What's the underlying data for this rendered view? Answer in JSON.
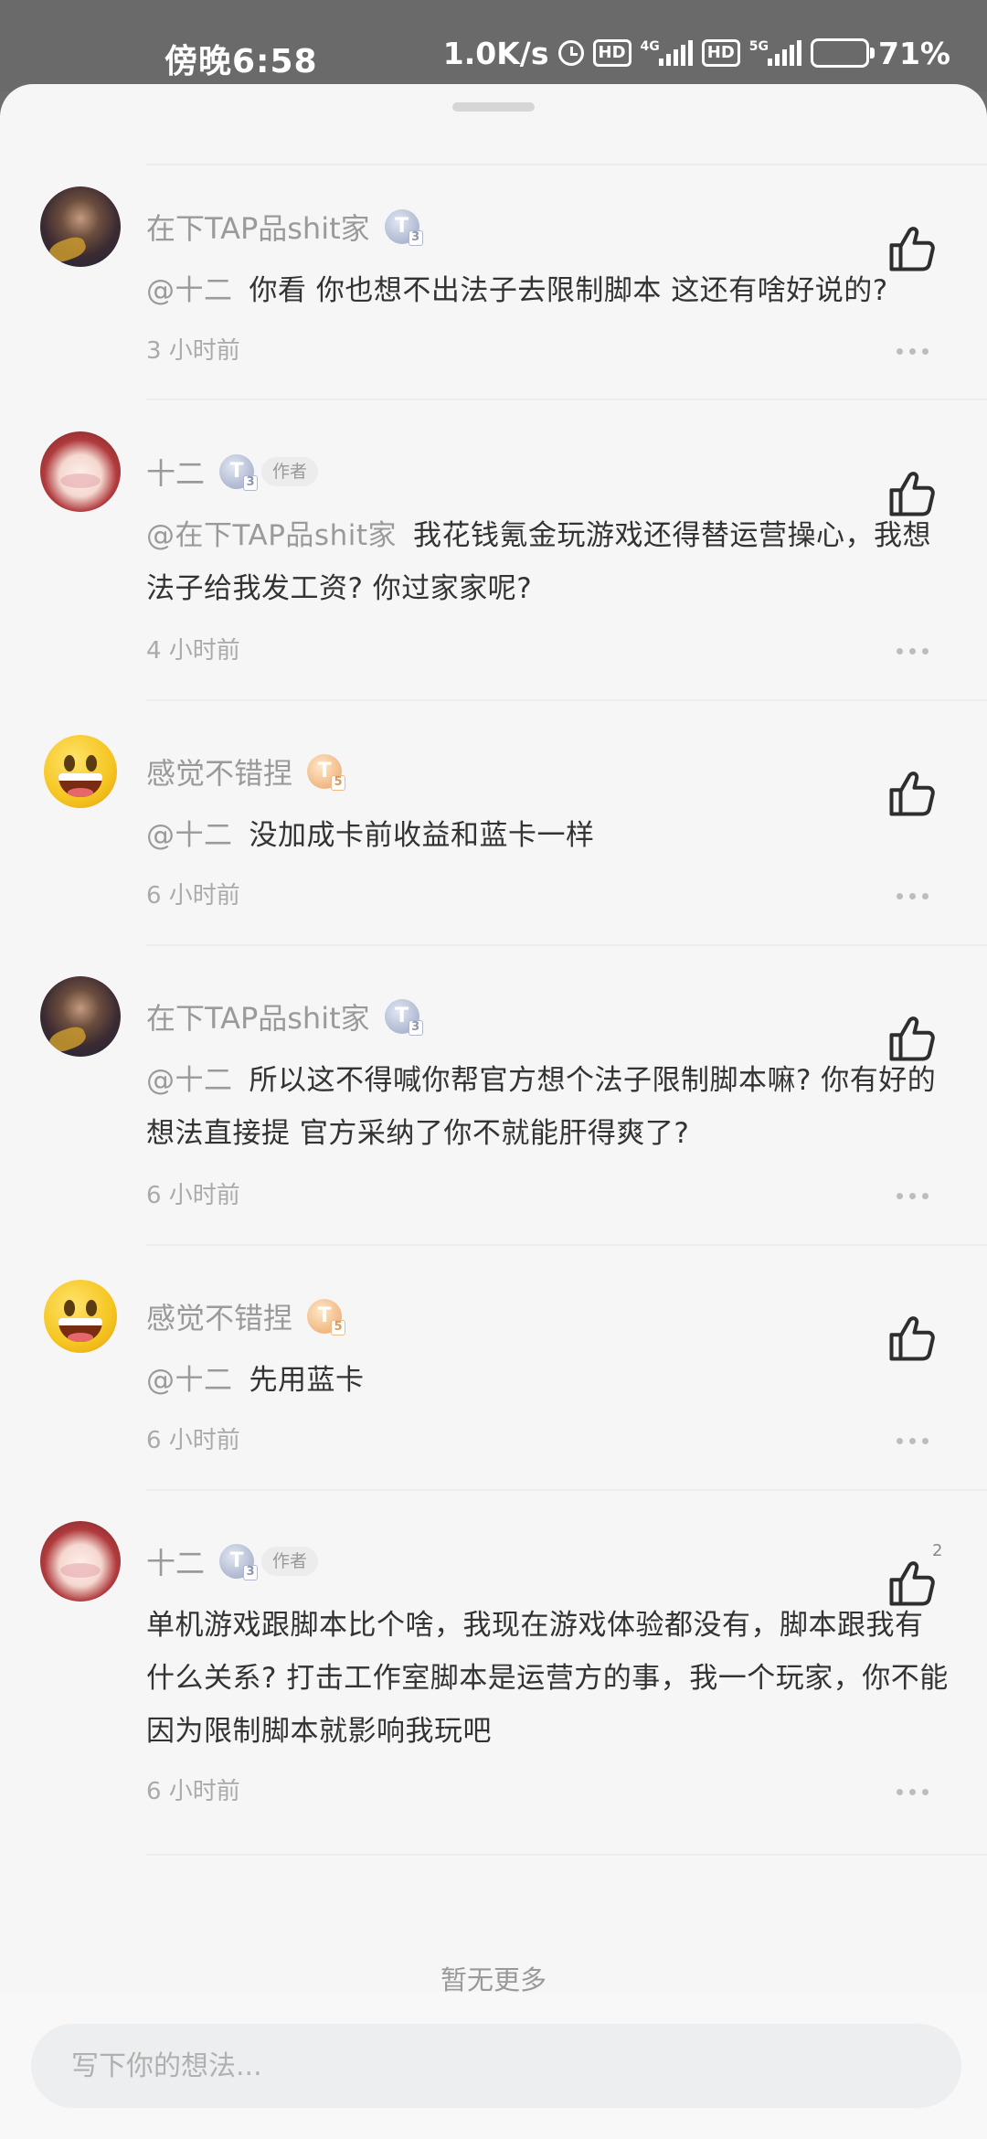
{
  "status_bar": {
    "time": "傍晚6:58",
    "net_speed": "1.0K/s",
    "hd_1": "HD",
    "net_type_1": "4G",
    "hd_2": "HD",
    "net_type_2": "5G",
    "battery": "71%"
  },
  "comments": [
    {
      "user": "在下TAP品shit家",
      "level": "T",
      "level_sub": "3",
      "mention": "@十二",
      "text": "你看 你也想不出法子去限制脚本 这还有啥好说的?",
      "time": "3 小时前",
      "like_count": ""
    },
    {
      "user": "十二",
      "level": "T",
      "level_sub": "3",
      "tag": "作者",
      "mention": "@在下TAP品shit家",
      "text": "我花钱氪金玩游戏还得替运营操心，我想法子给我发工资? 你过家家呢?",
      "time": "4 小时前",
      "like_count": ""
    },
    {
      "user": "感觉不错捏",
      "level": "T",
      "level_sub": "5",
      "mention": "@十二",
      "text": "没加成卡前收益和蓝卡一样",
      "time": "6 小时前",
      "like_count": ""
    },
    {
      "user": "在下TAP品shit家",
      "level": "T",
      "level_sub": "3",
      "mention": "@十二",
      "text": "所以这不得喊你帮官方想个法子限制脚本嘛? 你有好的想法直接提 官方采纳了你不就能肝得爽了?",
      "time": "6 小时前",
      "like_count": ""
    },
    {
      "user": "感觉不错捏",
      "level": "T",
      "level_sub": "5",
      "mention": "@十二",
      "text": "先用蓝卡",
      "time": "6 小时前",
      "like_count": ""
    },
    {
      "user": "十二",
      "level": "T",
      "level_sub": "3",
      "tag": "作者",
      "mention": "",
      "text": "单机游戏跟脚本比个啥，我现在游戏体验都没有，脚本跟我有什么关系? 打击工作室脚本是运营方的事，我一个玩家，你不能因为限制脚本就影响我玩吧",
      "time": "6 小时前",
      "like_count": "2"
    }
  ],
  "footer": {
    "no_more": "暂无更多",
    "input_placeholder": "写下你的想法..."
  },
  "icons": {
    "like": "thumbs-up-icon",
    "more": "more-icon",
    "alarm": "alarm-icon",
    "battery": "battery-icon"
  }
}
